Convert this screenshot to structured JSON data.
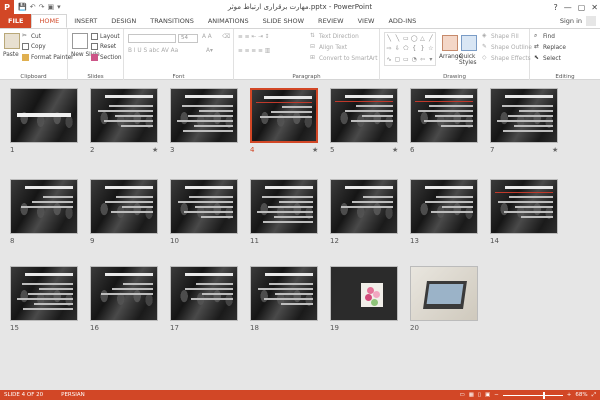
{
  "titlebar": {
    "app_icon_label": "P",
    "title": "مهارت برقرارى ارتباط موثر.pptx - PowerPoint",
    "minimize": "—",
    "maximize": "▢",
    "close": "✕",
    "help": "?"
  },
  "tabs": {
    "file": "FILE",
    "items": [
      "HOME",
      "INSERT",
      "DESIGN",
      "TRANSITIONS",
      "ANIMATIONS",
      "SLIDE SHOW",
      "REVIEW",
      "VIEW",
      "ADD-INS"
    ],
    "active_index": 0,
    "signin": "Sign in"
  },
  "ribbon": {
    "clipboard": {
      "label": "Clipboard",
      "paste": "Paste",
      "cut": "Cut",
      "copy": "Copy",
      "format_painter": "Format Painter"
    },
    "slides": {
      "label": "Slides",
      "new_slide": "New Slide",
      "layout": "Layout",
      "reset": "Reset",
      "section": "Section"
    },
    "font": {
      "label": "Font",
      "font_size": "54"
    },
    "paragraph": {
      "label": "Paragraph",
      "text_direction": "Text Direction",
      "align_text": "Align Text",
      "convert_smartart": "Convert to SmartArt"
    },
    "drawing": {
      "label": "Drawing",
      "arrange": "Arrange",
      "quick_styles": "Quick Styles",
      "shape_fill": "Shape Fill",
      "shape_outline": "Shape Outline",
      "shape_effects": "Shape Effects"
    },
    "editing": {
      "label": "Editing",
      "find": "Find",
      "replace": "Replace",
      "select": "Select"
    }
  },
  "slides": [
    {
      "number": "1",
      "star": ""
    },
    {
      "number": "2",
      "star": "★"
    },
    {
      "number": "3",
      "star": ""
    },
    {
      "number": "4",
      "star": "★"
    },
    {
      "number": "5",
      "star": "★"
    },
    {
      "number": "6",
      "star": ""
    },
    {
      "number": "7",
      "star": "★"
    },
    {
      "number": "8",
      "star": ""
    },
    {
      "number": "9",
      "star": ""
    },
    {
      "number": "10",
      "star": ""
    },
    {
      "number": "11",
      "star": ""
    },
    {
      "number": "12",
      "star": ""
    },
    {
      "number": "13",
      "star": ""
    },
    {
      "number": "14",
      "star": ""
    },
    {
      "number": "15",
      "star": ""
    },
    {
      "number": "16",
      "star": ""
    },
    {
      "number": "17",
      "star": ""
    },
    {
      "number": "18",
      "star": ""
    },
    {
      "number": "19",
      "star": ""
    },
    {
      "number": "20",
      "star": ""
    }
  ],
  "selected_slide": "4",
  "status": {
    "slide_info": "SLIDE 4 OF 20",
    "language": "PERSIAN",
    "zoom": "68%",
    "zoom_fraction": 0.68
  },
  "colors": {
    "accent": "#d24726",
    "selection": "#d24726"
  }
}
